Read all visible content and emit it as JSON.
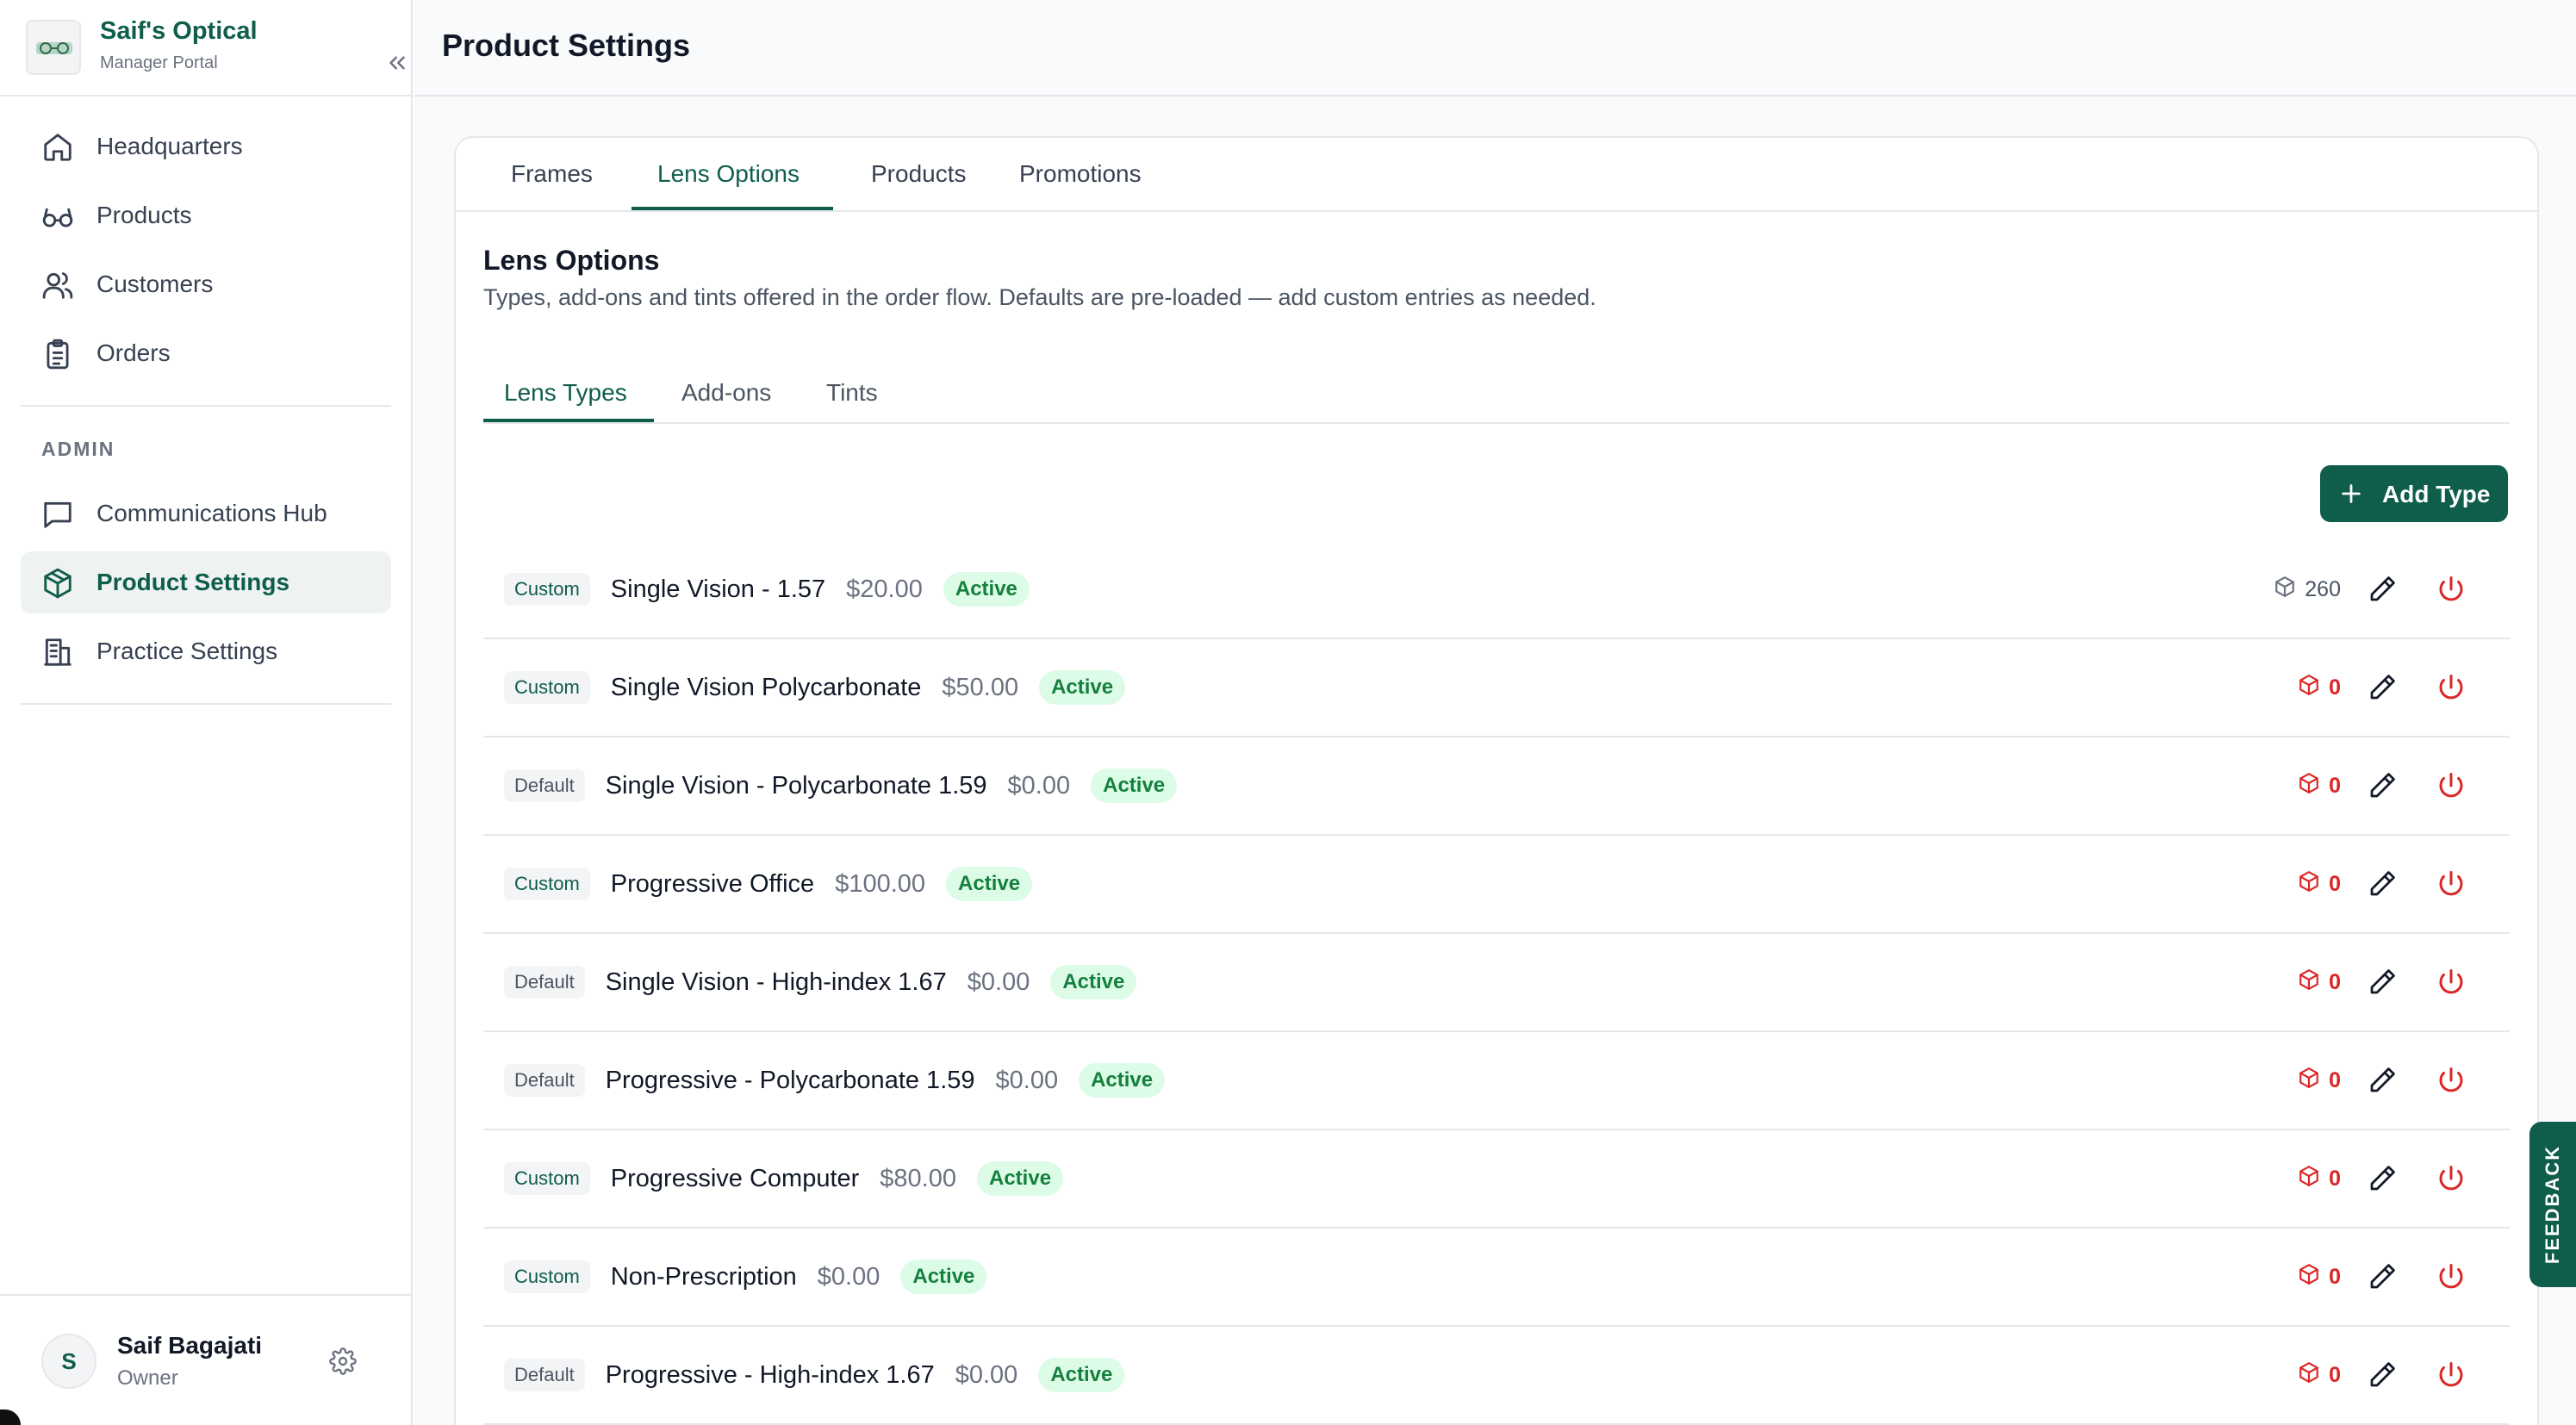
{
  "brand": {
    "name": "Saif's Optical",
    "subtitle": "Manager Portal"
  },
  "sidebar": {
    "items": [
      {
        "label": "Headquarters",
        "icon": "home-icon"
      },
      {
        "label": "Products",
        "icon": "glasses-icon"
      },
      {
        "label": "Customers",
        "icon": "users-icon"
      },
      {
        "label": "Orders",
        "icon": "clipboard-icon"
      }
    ],
    "admin_label": "ADMIN",
    "admin_items": [
      {
        "label": "Communications Hub",
        "icon": "message-icon"
      },
      {
        "label": "Product Settings",
        "icon": "package-icon",
        "active": true
      },
      {
        "label": "Practice Settings",
        "icon": "building-icon"
      }
    ]
  },
  "user": {
    "initial": "S",
    "name": "Saif Bagajati",
    "role": "Owner"
  },
  "header": {
    "title": "Product Settings"
  },
  "top_tabs": [
    {
      "label": "Frames"
    },
    {
      "label": "Lens Options",
      "active": true
    },
    {
      "label": "Products"
    },
    {
      "label": "Promotions"
    }
  ],
  "section": {
    "title": "Lens Options",
    "description": "Types, add-ons and tints offered in the order flow. Defaults are pre-loaded — add custom entries as needed."
  },
  "sub_tabs": [
    {
      "label": "Lens Types",
      "active": true
    },
    {
      "label": "Add-ons"
    },
    {
      "label": "Tints"
    }
  ],
  "add_button": {
    "label": "Add Type"
  },
  "lens_types": [
    {
      "tag": "Custom",
      "name": "Single Vision - 1.57",
      "price": "$20.00",
      "status": "Active",
      "count": "260"
    },
    {
      "tag": "Custom",
      "name": "Single Vision Polycarbonate",
      "price": "$50.00",
      "status": "Active",
      "count": "0"
    },
    {
      "tag": "Default",
      "name": "Single Vision - Polycarbonate 1.59",
      "price": "$0.00",
      "status": "Active",
      "count": "0"
    },
    {
      "tag": "Custom",
      "name": "Progressive Office",
      "price": "$100.00",
      "status": "Active",
      "count": "0"
    },
    {
      "tag": "Default",
      "name": "Single Vision - High-index 1.67",
      "price": "$0.00",
      "status": "Active",
      "count": "0"
    },
    {
      "tag": "Default",
      "name": "Progressive - Polycarbonate 1.59",
      "price": "$0.00",
      "status": "Active",
      "count": "0"
    },
    {
      "tag": "Custom",
      "name": "Progressive Computer",
      "price": "$80.00",
      "status": "Active",
      "count": "0"
    },
    {
      "tag": "Custom",
      "name": "Non-Prescription",
      "price": "$0.00",
      "status": "Active",
      "count": "0"
    },
    {
      "tag": "Default",
      "name": "Progressive - High-index 1.67",
      "price": "$0.00",
      "status": "Active",
      "count": "0"
    }
  ],
  "feedback": {
    "label": "FEEDBACK"
  },
  "colors": {
    "brand": "#0f5d4b",
    "active_bg": "#dcfce7",
    "active_text": "#15803d",
    "danger": "#dc2626"
  }
}
